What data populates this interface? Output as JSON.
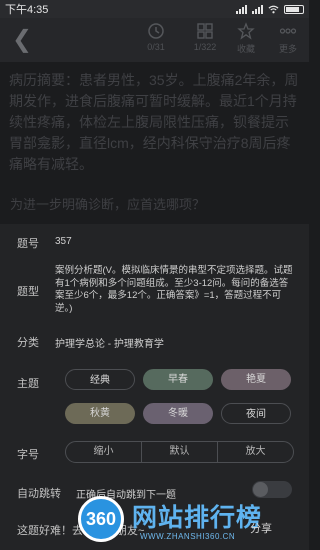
{
  "status_bar": {
    "time": "下午4:35"
  },
  "toolbar": {
    "items": [
      {
        "label": "0/31",
        "icon": "clock-icon"
      },
      {
        "label": "1/322",
        "icon": "grid-icon"
      },
      {
        "label": "收藏",
        "icon": "star-icon"
      },
      {
        "label": "更多",
        "icon": "more-icon"
      }
    ]
  },
  "question": {
    "text": "病历摘要：患者男性，35岁。上腹痛2年余，周期发作，进食后腹痛可暂时缓解。最近1个月持续性疼痛，体检左上腹局限性压痛，钡餐提示胃部龛影，直径lcm，经内科保守治疗8周后疼痛略有减轻。",
    "prompt": "为进一步明确诊断，应首选哪项？"
  },
  "panel": {
    "number_label": "题号",
    "number_value": "357",
    "type_label": "题型",
    "type_value": "案例分析题(V。模拟临床情景的串型不定项选择题。试题有1个病例和多个问题组成。至少3-12问。每问的备选答案至少6个，最多12个。正确答案》=1，答题过程不可逆。)",
    "category_label": "分类",
    "category_value": "护理学总论 - 护理教育学",
    "theme_label": "主题",
    "themes": [
      "经典",
      "早春",
      "艳夏",
      "秋黄",
      "冬暖",
      "夜间"
    ],
    "font_label": "字号",
    "font_options": [
      "缩小",
      "默认",
      "放大"
    ],
    "auto_label": "自动跳转",
    "auto_desc": "正确后自动跳到下一题",
    "bottom_text": "这题好难！去考考我朋友~",
    "share_label": "分享"
  },
  "watermark": {
    "logo_text": "360",
    "title": "网站排行榜",
    "url": "WWW.ZHANSHI360.CN"
  },
  "colors": {
    "theme_spring": "#566a5e",
    "theme_summer": "#6c6069",
    "theme_autumn": "#6d6a57",
    "theme_winter": "#6a6170"
  }
}
